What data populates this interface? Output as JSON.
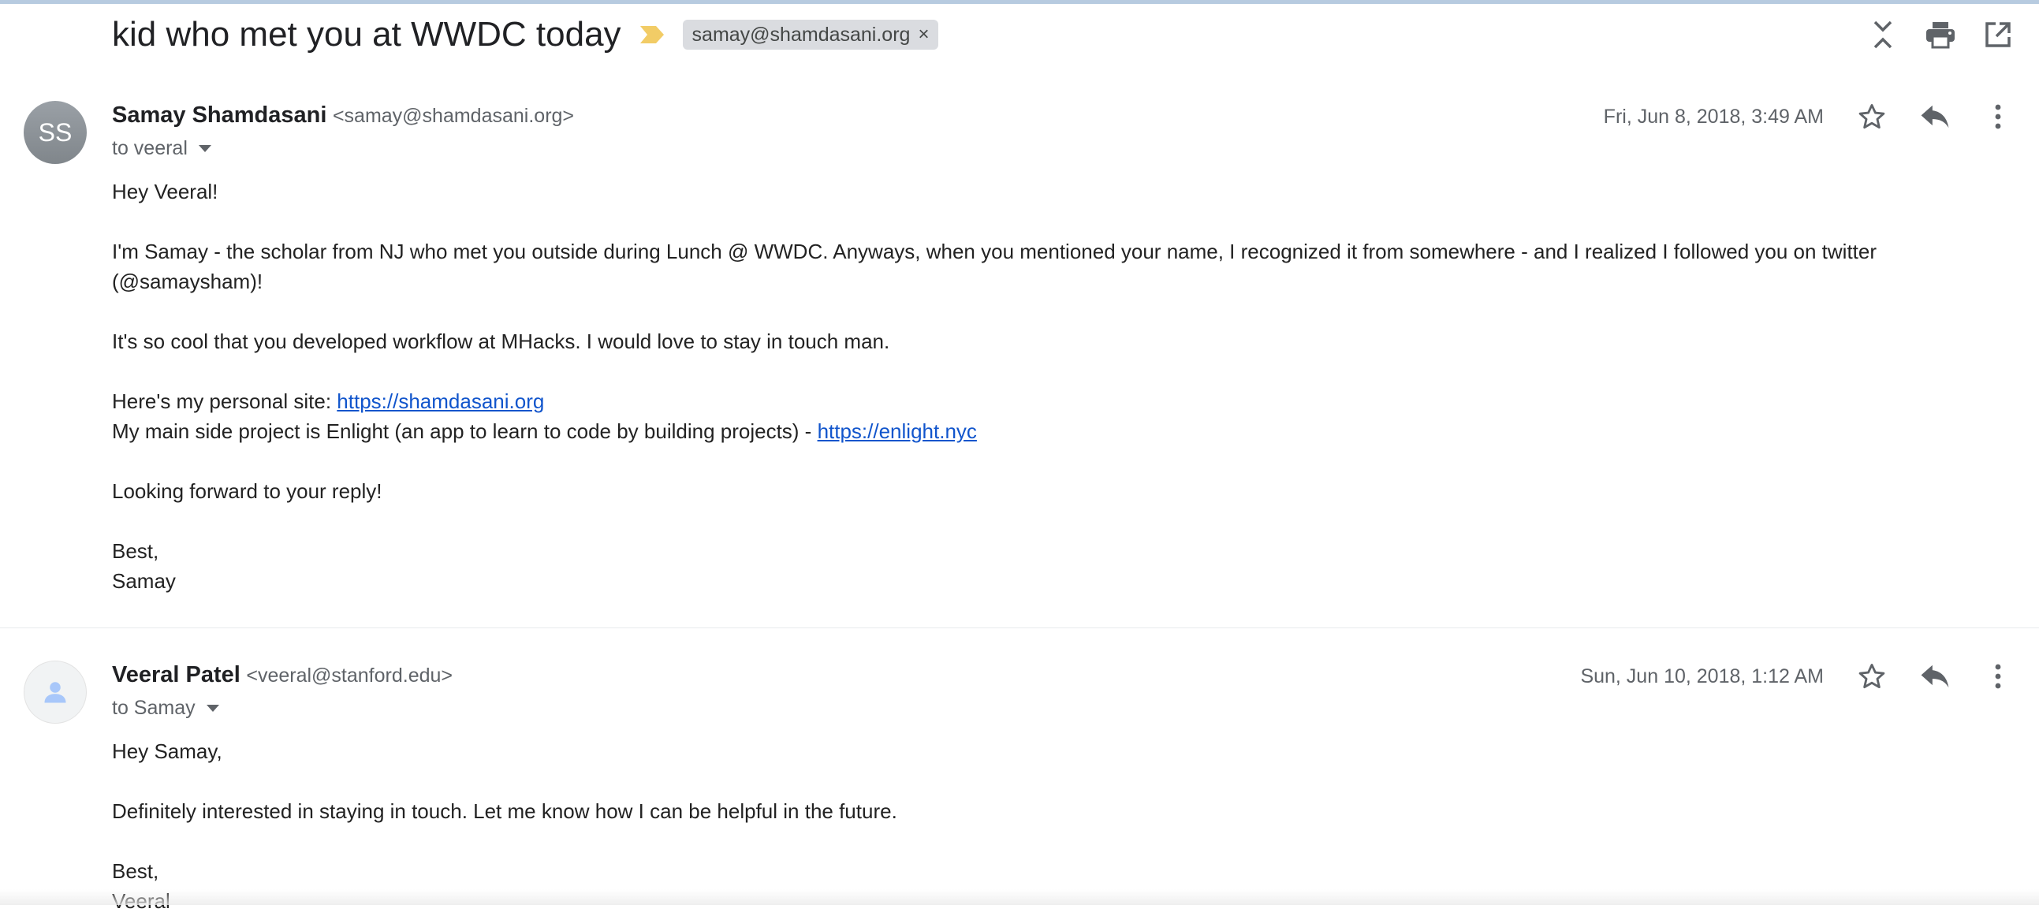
{
  "thread": {
    "subject": "kid who met you at WWDC today",
    "label": "samay@shamdasani.org",
    "label_remove": "×"
  },
  "toolbar": {
    "icons": [
      "collapse-all-icon",
      "print-icon",
      "open-new-window-icon"
    ]
  },
  "messages": [
    {
      "avatar_initials": "SS",
      "sender_name": "Samay Shamdasani",
      "sender_email": "<samay@shamdasani.org>",
      "to": "to veeral",
      "date": "Fri, Jun 8, 2018, 3:49 AM",
      "greeting": "Hey Veeral!",
      "para1": "I'm Samay - the scholar from NJ who met you outside during Lunch @ WWDC. Anyways, when you mentioned your name, I recognized it from somewhere - and I realized I followed you on twitter (@samaysham)!",
      "para2": "It's so cool that you developed workflow at MHacks. I would love to stay in touch man.",
      "site_prefix": "Here's my personal site: ",
      "site_link": "https://shamdasani.org",
      "project_prefix": "My main side project is Enlight (an app to learn to code by building projects) - ",
      "project_link": "https://enlight.nyc",
      "closing_line": "Looking forward to your reply!",
      "signoff": "Best,",
      "signature": "Samay"
    },
    {
      "avatar_icon": "person-icon",
      "sender_name": "Veeral Patel",
      "sender_email": "<veeral@stanford.edu>",
      "to": "to Samay",
      "date": "Sun, Jun 10, 2018, 1:12 AM",
      "greeting": "Hey Samay,",
      "para1": "Definitely interested in staying in touch. Let me know how I can be helpful in the future.",
      "signoff": "Best,",
      "signature": "Veeral"
    }
  ],
  "colors": {
    "link": "#1155cc",
    "importance": "#f2cc66",
    "chip_bg": "#dadce0",
    "icon": "#5f6368"
  }
}
